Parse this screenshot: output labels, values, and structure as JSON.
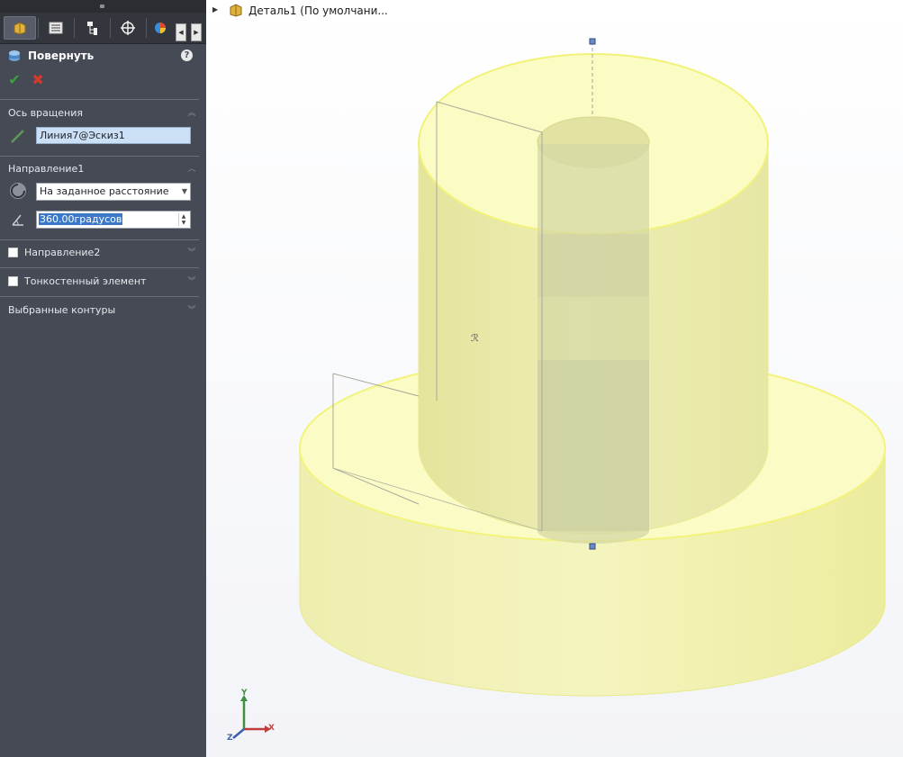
{
  "property_manager": {
    "tabs": [
      {
        "name": "feature-manager-tab",
        "icon": "part-tree-icon",
        "active": true
      },
      {
        "name": "property-manager-tab",
        "icon": "property-list-icon",
        "active": false
      },
      {
        "name": "configuration-manager-tab",
        "icon": "configuration-icon",
        "active": false
      },
      {
        "name": "dimxpert-manager-tab",
        "icon": "dimxpert-icon",
        "active": false
      },
      {
        "name": "display-manager-tab",
        "icon": "appearance-pie-icon",
        "active": false
      }
    ],
    "feature_title": "Повернуть",
    "help_icon": "?",
    "ok_icon": "✔",
    "cancel_icon": "✖",
    "axis_section": {
      "header": "Ось вращения",
      "axis_value": "Линия7@Эскиз1"
    },
    "direction1_section": {
      "header": "Направление1",
      "end_condition": "На заданное расстояние",
      "angle_value": "360.00градусов"
    },
    "direction2_label": "Направление2",
    "direction2_checked": false,
    "thin_feature_label": "Тонкостенный элемент",
    "thin_feature_checked": false,
    "selected_contours_header": "Выбранные контуры"
  },
  "viewport": {
    "part_name": "Деталь1  (По умолчани...",
    "model_color": "#ffffb4",
    "triad_labels": {
      "x": "X",
      "y": "Y",
      "z": "Z"
    }
  }
}
